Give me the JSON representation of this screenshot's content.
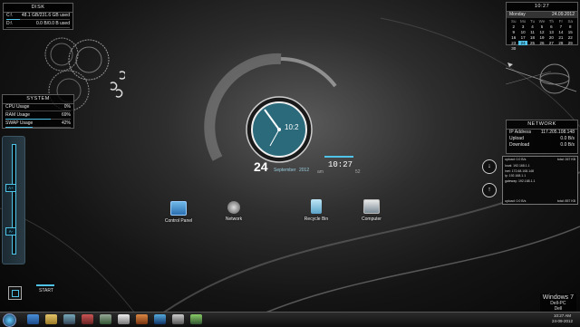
{
  "disk": {
    "title": "DISK",
    "rows": [
      {
        "label": "C:\\",
        "value": "48.1 GB/231.6 GB used",
        "fill": 0.21
      },
      {
        "label": "D:\\",
        "value": "0.0 B/0.0 B used",
        "fill": 0.0
      }
    ]
  },
  "system": {
    "title": "SYSTEM",
    "rows": [
      {
        "label": "CPU Usage",
        "value": "0%",
        "fill": 0.0
      },
      {
        "label": "RAM Usage",
        "value": "69%",
        "fill": 0.69
      },
      {
        "label": "SWAP Usage",
        "value": "42%",
        "fill": 0.42
      }
    ]
  },
  "calendar": {
    "time": "10:27",
    "day": "Monday",
    "date": "24.09.2012",
    "weekdays": [
      "Su",
      "Mo",
      "Tu",
      "We",
      "Th",
      "Fr",
      "Sa"
    ],
    "weeks": [
      [
        "2",
        "3",
        "4",
        "5",
        "6",
        "7",
        "8"
      ],
      [
        "9",
        "10",
        "11",
        "12",
        "13",
        "14",
        "15"
      ],
      [
        "16",
        "17",
        "18",
        "19",
        "20",
        "21",
        "22"
      ],
      [
        "23",
        "24",
        "25",
        "26",
        "27",
        "28",
        "29"
      ],
      [
        "30",
        "",
        "",
        "",
        "",
        "",
        ""
      ]
    ],
    "today": "24"
  },
  "network": {
    "title": "NETWORK",
    "rows": [
      {
        "label": "IP Address",
        "value": "117.205.108.148"
      },
      {
        "label": "Upload",
        "value": "0.0 B/s"
      },
      {
        "label": "Download",
        "value": "0.0 B/s"
      }
    ],
    "graph": {
      "up_label": "upload: 0.0 B/s",
      "total_up": "total: 267 KB",
      "ip_lines": [
        "local: 192.168.1.1",
        "inet: 172.68.108.148",
        "ip: 192.168.1.1",
        "gateway: 192.168.1.1"
      ],
      "down_label": "upload: 0.0 B/s",
      "total_down": "total: 857 KB"
    }
  },
  "center_clock": {
    "time": "10:2",
    "day_num": "24",
    "month": "September",
    "year": "2012",
    "digital": "10:27",
    "am": "am",
    "sec": "52"
  },
  "desktop_icons": [
    {
      "label": "Control Panel",
      "icon": "control-panel-icon"
    },
    {
      "label": "Network",
      "icon": "network-icon"
    },
    {
      "label": "Recycle Bin",
      "icon": "recycle-bin-icon"
    },
    {
      "label": "Computer",
      "icon": "computer-icon"
    }
  ],
  "dock": {
    "start_label": "START",
    "a_plus": "A+",
    "a_minus": "A-"
  },
  "watermark": {
    "line1": "Windows 7",
    "line2": "Dell-PC",
    "line3": "Dell"
  },
  "tray": {
    "time": "10:27 AM",
    "date": "24-09-2012"
  },
  "colors": {
    "accent": "#4fc3e8",
    "clock_face": "#2a6a7a"
  }
}
